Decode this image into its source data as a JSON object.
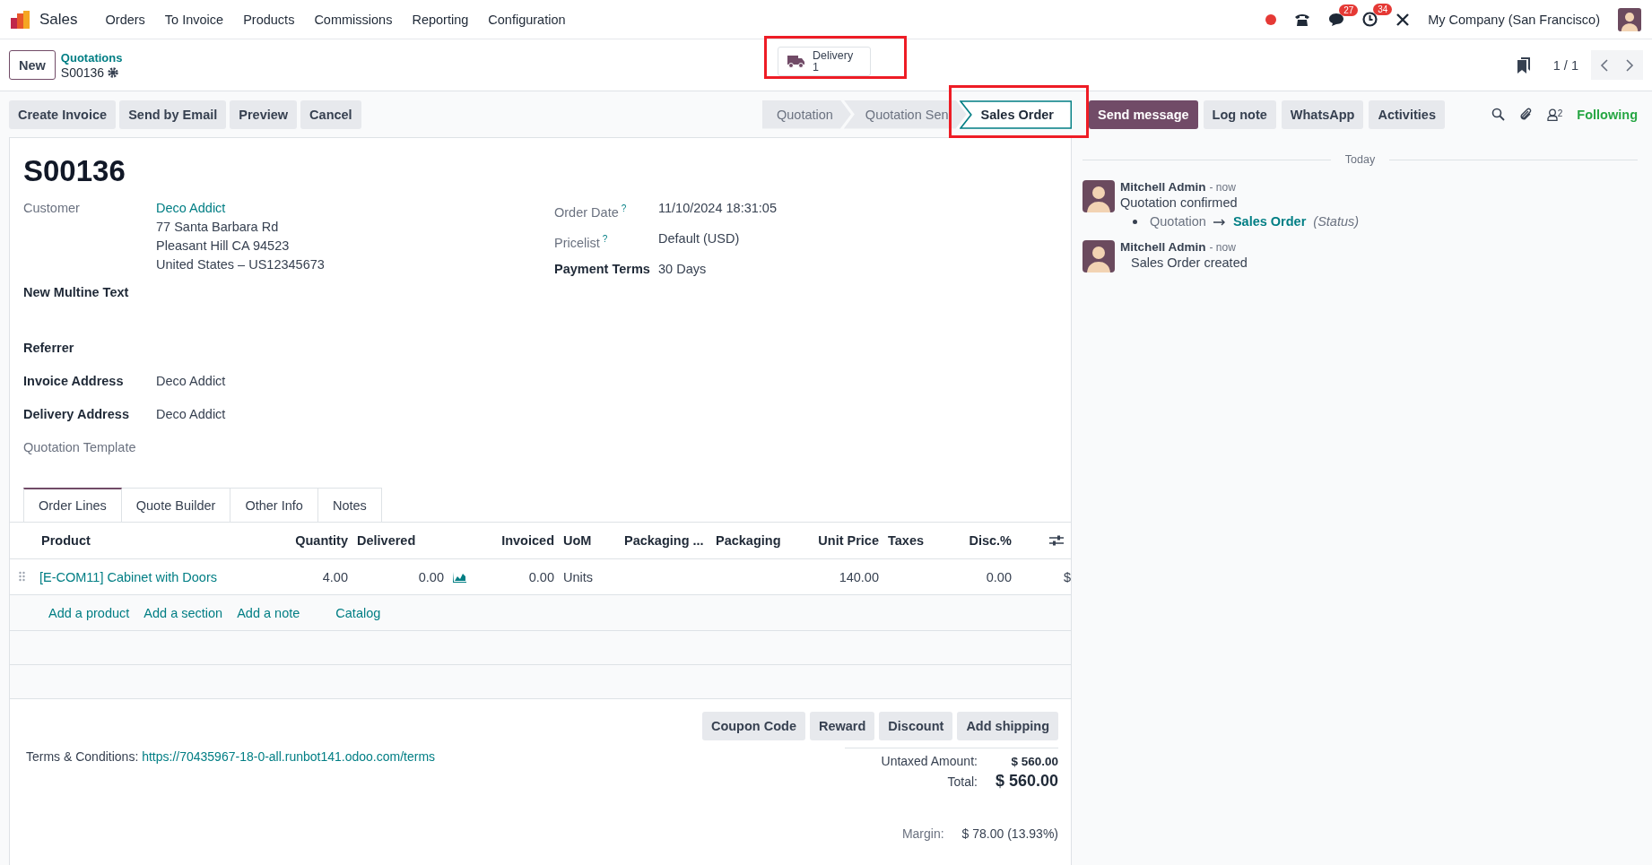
{
  "app": {
    "name": "Sales",
    "menu": [
      "Orders",
      "To Invoice",
      "Products",
      "Commissions",
      "Reporting",
      "Configuration"
    ]
  },
  "systray": {
    "chat_count": "27",
    "activity_count": "34",
    "company": "My Company (San Francisco)"
  },
  "new_button": "New",
  "breadcrumb": {
    "parent": "Quotations",
    "current": "S00136"
  },
  "stat_button": {
    "label": "Delivery",
    "value": "1",
    "highlighted": true
  },
  "pager": "1 / 1",
  "actions": [
    "Create Invoice",
    "Send by Email",
    "Preview",
    "Cancel"
  ],
  "statusbar": [
    {
      "label": "Quotation",
      "selected": false,
      "highlighted": false
    },
    {
      "label": "Quotation Sen",
      "selected": false,
      "highlighted": false
    },
    {
      "label": "Sales Order",
      "selected": true,
      "highlighted": true
    }
  ],
  "chatter_buttons": [
    {
      "label": "Send message",
      "primary": true
    },
    {
      "label": "Log note",
      "primary": false
    },
    {
      "label": "WhatsApp",
      "primary": false
    },
    {
      "label": "Activities",
      "primary": false
    }
  ],
  "followers": "2",
  "following": "Following",
  "form": {
    "title": "S00136",
    "left_fields": [
      {
        "label": "Customer",
        "bold": false,
        "kind": "partner",
        "value": "Deco Addict",
        "lines": [
          "77 Santa Barbara Rd",
          "Pleasant Hill CA 94523",
          "United States – US12345673"
        ]
      },
      {
        "label": "New Multine Text",
        "bold": true,
        "kind": "multiline"
      },
      {
        "label": "Referrer",
        "bold": true,
        "kind": "text"
      },
      {
        "label": "Invoice Address",
        "bold": true,
        "kind": "text",
        "value": "Deco Addict"
      },
      {
        "label": "Delivery Address",
        "bold": true,
        "kind": "text",
        "value": "Deco Addict"
      },
      {
        "label": "Quotation Template",
        "bold": false,
        "kind": "text"
      }
    ],
    "right_fields": [
      {
        "label": "Order Date",
        "bold": false,
        "help": "?",
        "value": "11/10/2024 18:31:05"
      },
      {
        "label": "Pricelist",
        "bold": false,
        "help": "?",
        "value": "Default (USD)"
      },
      {
        "label": "Payment Terms",
        "bold": true,
        "value": "30 Days"
      }
    ]
  },
  "tabs": [
    {
      "label": "Order Lines",
      "selected": true
    },
    {
      "label": "Quote Builder",
      "selected": false
    },
    {
      "label": "Other Info",
      "selected": false
    },
    {
      "label": "Notes",
      "selected": false
    }
  ],
  "table": {
    "columns": [
      "Product",
      "Quantity",
      "Delivered",
      "Invoiced",
      "UoM",
      "Packaging ...",
      "Packaging",
      "Unit Price",
      "Taxes",
      "Disc.%"
    ],
    "rows": [
      {
        "product": "[E-COM11] Cabinet with Doors",
        "quantity": "4.00",
        "delivered": "0.00",
        "invoiced": "0.00",
        "uom": "Units",
        "unit_price": "140.00",
        "discount": "0.00",
        "column_12": "$"
      }
    ]
  },
  "add_links": [
    "Add a product",
    "Add a section",
    "Add a note",
    "Catalog"
  ],
  "promo_buttons": [
    "Coupon Code",
    "Reward",
    "Discount",
    "Add shipping"
  ],
  "terms": {
    "label": "Terms & Conditions:",
    "url": "https://70435967-18-0-all.runbot141.odoo.com/terms"
  },
  "totals": {
    "untaxed_label": "Untaxed Amount:",
    "untaxed": "$ 560.00",
    "total_label": "Total:",
    "total": "$ 560.00",
    "margin_label": "Margin:",
    "margin": "$ 78.00 (13.93%)"
  },
  "chatter": {
    "date": "Today",
    "messages": [
      {
        "author": "Mitchell Admin",
        "time": "- now",
        "body": "Quotation confirmed",
        "tracking": {
          "old": "Quotation",
          "new": "Sales Order",
          "field": "(Status)"
        }
      },
      {
        "author": "Mitchell Admin",
        "time": "- now",
        "body": "Sales Order created"
      }
    ]
  }
}
